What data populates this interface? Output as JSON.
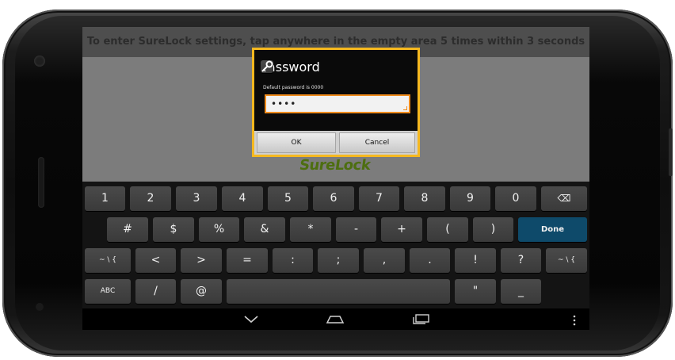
{
  "topbar": {
    "text": "To enter SureLock settings, tap anywhere in the empty area 5 times within 3 seconds"
  },
  "brand": {
    "logo_text": "SureLock",
    "logo_color": "#4d6e10"
  },
  "dialog": {
    "title": "Password",
    "hint": "Default password is 0000",
    "input_value": "••••",
    "ok_label": "OK",
    "cancel_label": "Cancel",
    "highlight_color": "#f5b81f"
  },
  "keyboard": {
    "row1": [
      "1",
      "2",
      "3",
      "4",
      "5",
      "6",
      "7",
      "8",
      "9",
      "0",
      "⌫"
    ],
    "row2": [
      "#",
      "$",
      "%",
      "&",
      "*",
      "-",
      "+",
      "(",
      ")",
      "Done"
    ],
    "row3": [
      "~ \\ {",
      "<",
      ">",
      "=",
      ":",
      ";",
      ",",
      ".",
      "!",
      "?",
      "~ \\ {"
    ],
    "row4": [
      "ABC",
      "/",
      "@",
      "",
      "\"",
      "_"
    ]
  },
  "nav": {
    "back_icon": "back-icon",
    "home_icon": "home-icon",
    "recents_icon": "recents-icon",
    "menu_icon": "overflow-menu-icon"
  }
}
